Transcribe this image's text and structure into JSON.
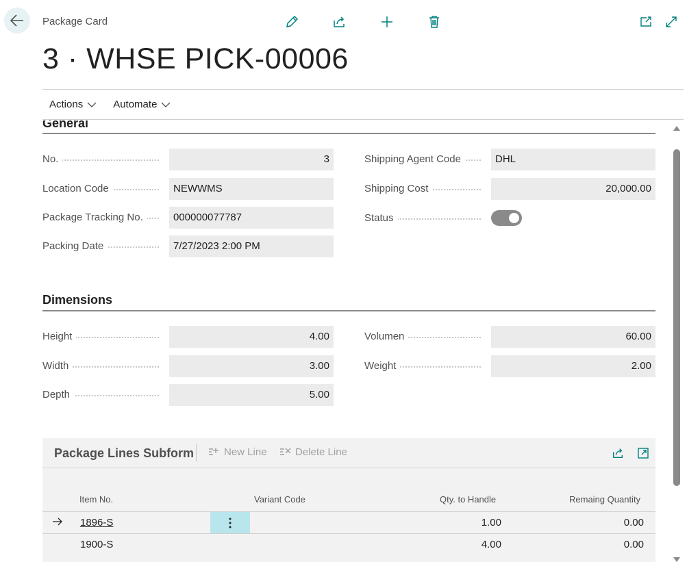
{
  "header": {
    "caption": "Package Card",
    "title": "3 · WHSE PICK-00006"
  },
  "actions": {
    "actions_label": "Actions",
    "automate_label": "Automate"
  },
  "general": {
    "section_title": "General",
    "no_label": "No.",
    "no_value": "3",
    "location_label": "Location Code",
    "location_value": "NEWWMS",
    "tracking_label": "Package Tracking No.",
    "tracking_value": "000000077787",
    "packing_date_label": "Packing Date",
    "packing_date_value": "7/27/2023 2:00 PM",
    "agent_label": "Shipping Agent Code",
    "agent_value": "DHL",
    "cost_label": "Shipping Cost",
    "cost_value": "20,000.00",
    "status_label": "Status",
    "status_on": true
  },
  "dimensions": {
    "section_title": "Dimensions",
    "height_label": "Height",
    "height_value": "4.00",
    "width_label": "Width",
    "width_value": "3.00",
    "depth_label": "Depth",
    "depth_value": "5.00",
    "volumen_label": "Volumen",
    "volumen_value": "60.00",
    "weight_label": "Weight",
    "weight_value": "2.00"
  },
  "subform": {
    "title": "Package Lines Subform",
    "new_line_label": "New Line",
    "delete_line_label": "Delete Line",
    "columns": {
      "item_no": "Item No.",
      "variant_code": "Variant Code",
      "qty_to_handle": "Qty. to Handle",
      "remaining_qty": "Remaing Quantity"
    },
    "rows": [
      {
        "item_no": "1896-S",
        "variant_code": "",
        "qty_to_handle": "1.00",
        "remaining_qty": "0.00"
      },
      {
        "item_no": "1900-S",
        "variant_code": "",
        "qty_to_handle": "4.00",
        "remaining_qty": "0.00"
      }
    ]
  },
  "colors": {
    "accent": "#00807f",
    "field_bg": "#ebebeb",
    "row_selected": "#b8e6ec"
  }
}
